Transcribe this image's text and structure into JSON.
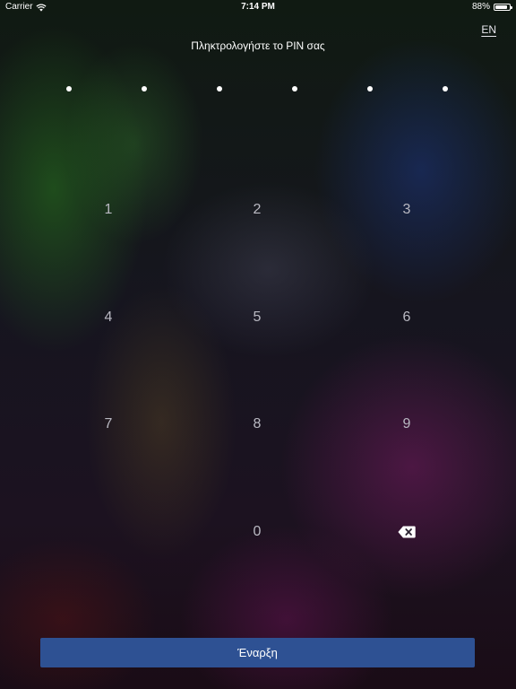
{
  "status_bar": {
    "carrier": "Carrier",
    "wifi_icon": "wifi-icon",
    "time": "7:14 PM",
    "battery_percent": "88%",
    "battery_level": 0.88,
    "battery_icon": "battery-icon"
  },
  "language_switch": {
    "label": "EN"
  },
  "pin_prompt": "Πληκτρολογήστε το PIN σας",
  "pin_dots": {
    "count": 6,
    "filled": 6
  },
  "keypad": {
    "keys": [
      "1",
      "2",
      "3",
      "4",
      "5",
      "6",
      "7",
      "8",
      "9",
      "0"
    ],
    "backspace_icon": "backspace-icon"
  },
  "start_button": {
    "label": "Έναρξη",
    "color": "#2e5193"
  }
}
